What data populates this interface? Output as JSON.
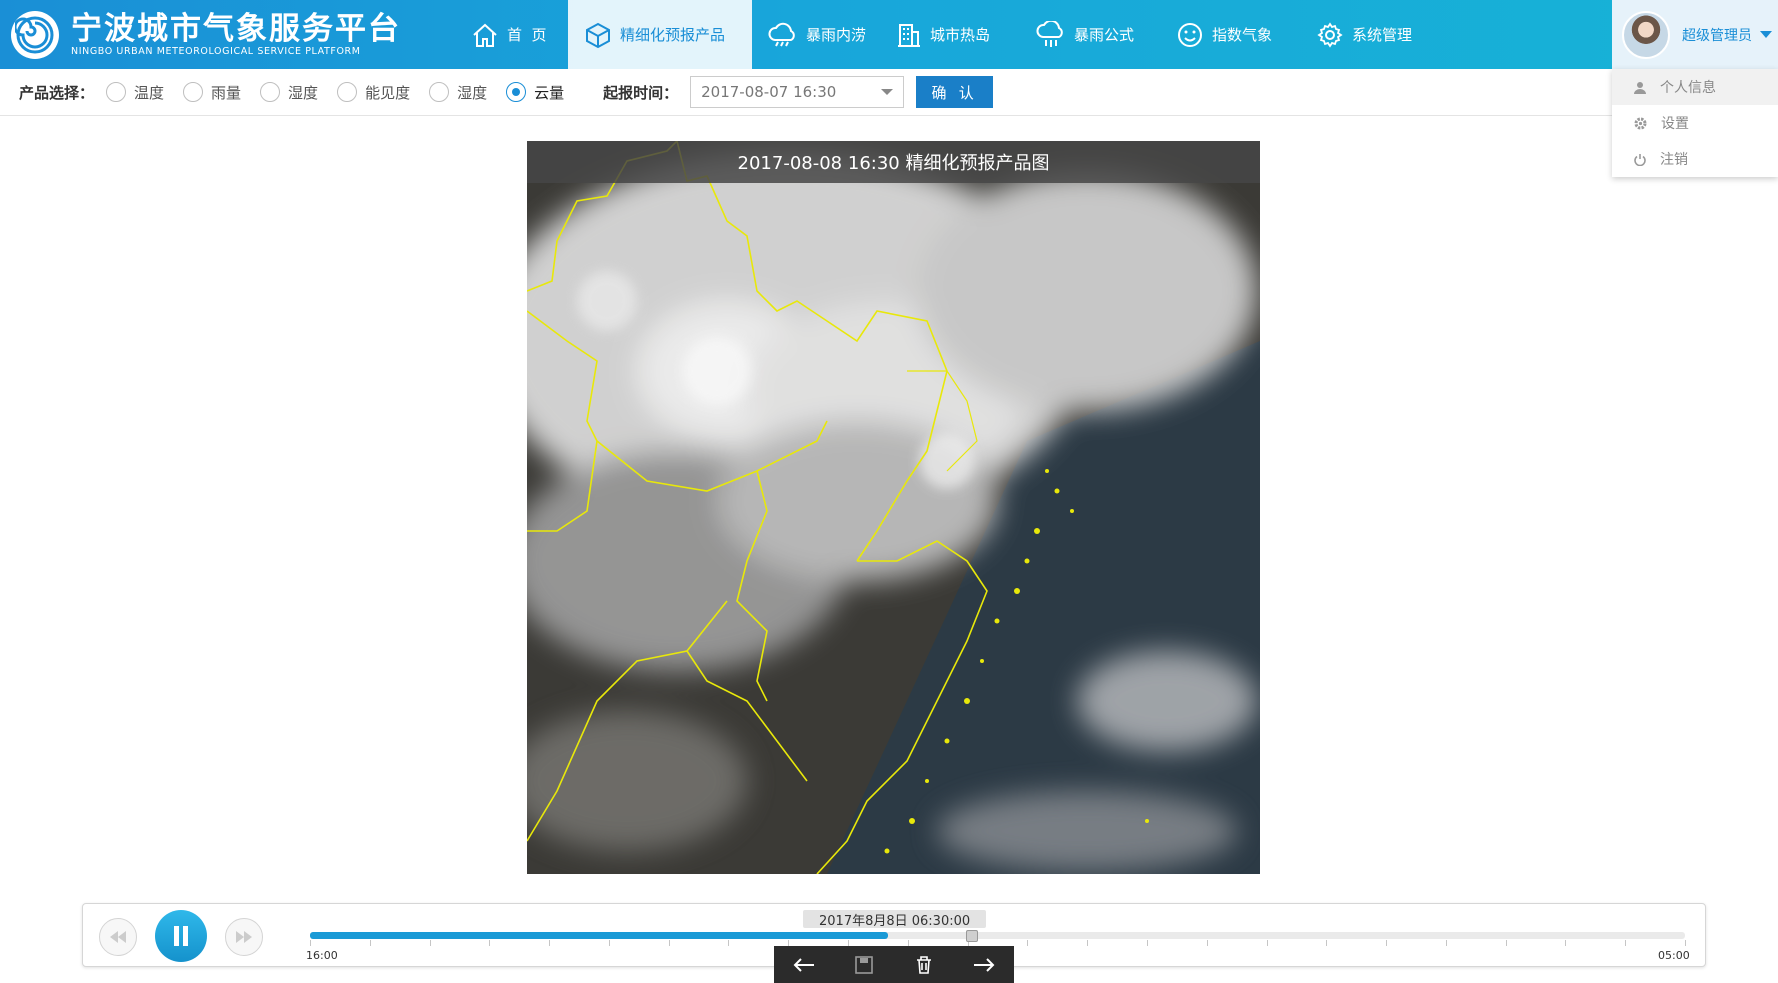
{
  "app": {
    "title": "宁波城市气象服务平台",
    "subtitle": "NINGBO URBAN METEOROLOGICAL SERVICE PLATFORM"
  },
  "nav": {
    "items": [
      {
        "label": "首  页",
        "icon": "home-icon"
      },
      {
        "label": "精细化预报产品",
        "icon": "cube-icon",
        "active": true
      },
      {
        "label": "暴雨内涝",
        "icon": "cloud-rain-icon"
      },
      {
        "label": "城市热岛",
        "icon": "building-icon"
      },
      {
        "label": "暴雨公式",
        "icon": "cloud-drip-icon"
      },
      {
        "label": "指数气象",
        "icon": "smiley-icon"
      },
      {
        "label": "系统管理",
        "icon": "gear-icon"
      }
    ]
  },
  "user": {
    "name": "超级管理员",
    "menu": [
      {
        "label": "个人信息",
        "icon": "user-icon"
      },
      {
        "label": "设置",
        "icon": "gear-icon"
      },
      {
        "label": "注销",
        "icon": "power-icon"
      }
    ]
  },
  "toolbar": {
    "product_label": "产品选择：",
    "products": [
      {
        "label": "温度",
        "checked": false
      },
      {
        "label": "雨量",
        "checked": false
      },
      {
        "label": "湿度",
        "checked": false
      },
      {
        "label": "能见度",
        "checked": false
      },
      {
        "label": "湿度",
        "checked": false
      },
      {
        "label": "云量",
        "checked": true
      }
    ],
    "time_label": "起报时间：",
    "time_value": "2017-08-07 16:30",
    "confirm_label": "确 认"
  },
  "map": {
    "title": "2017-08-08 16:30 精细化预报产品图"
  },
  "timeline": {
    "current_time": "2017年8月8日 06:30:00",
    "start_label": "16:00",
    "end_label": "05:00",
    "progress": 0.42
  },
  "colors": {
    "accent": "#1a8ed6",
    "boundary": "#e8e80a"
  }
}
